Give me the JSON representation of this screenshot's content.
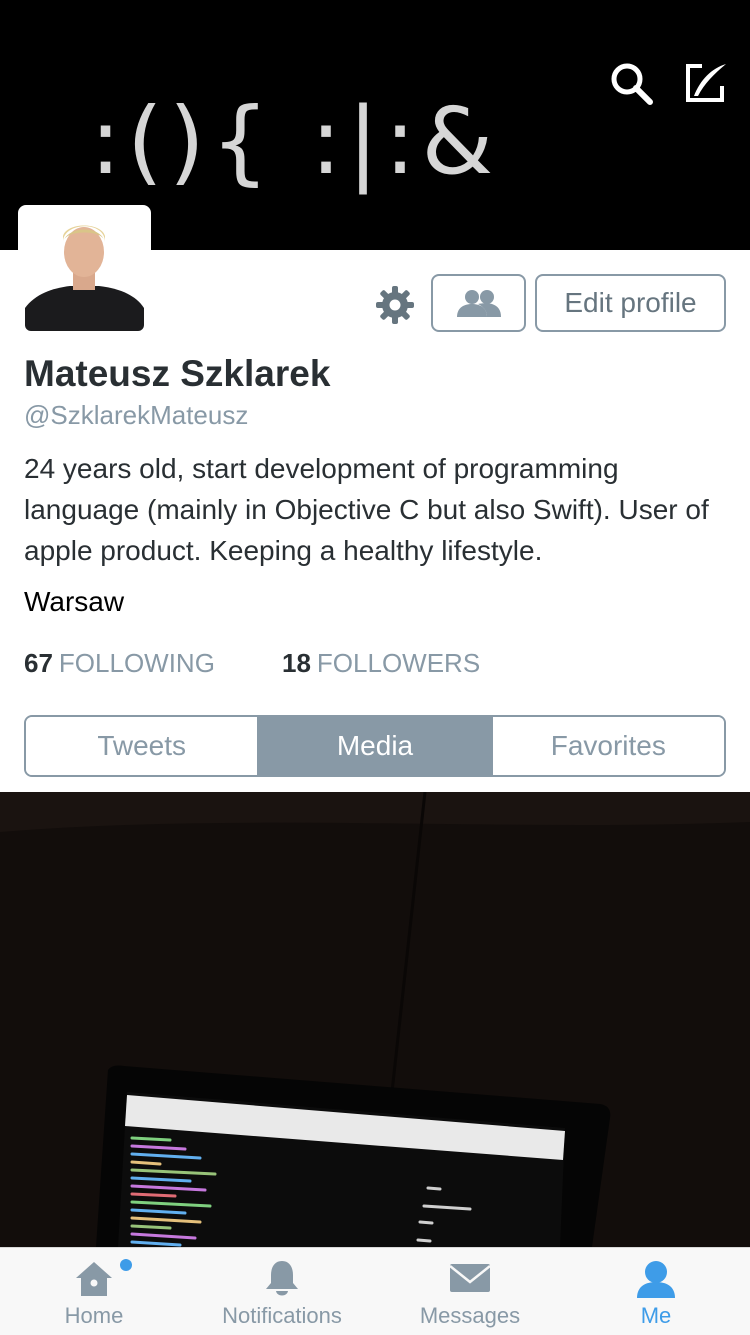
{
  "header": {
    "banner_text": ":(){ :|:&"
  },
  "actions": {
    "edit_profile_label": "Edit profile"
  },
  "profile": {
    "name": "Mateusz Szklarek",
    "handle": "@SzklarekMateusz",
    "bio": "24 years old, start development of programming language (mainly in Objective C but also Swift). User of apple product. Keeping a healthy lifestyle.",
    "location": "Warsaw"
  },
  "stats": {
    "following_count": "67",
    "following_label": "FOLLOWING",
    "followers_count": "18",
    "followers_label": "FOLLOWERS"
  },
  "tabs": [
    {
      "label": "Tweets",
      "active": false
    },
    {
      "label": "Media",
      "active": true
    },
    {
      "label": "Favorites",
      "active": false
    }
  ],
  "tabbar": [
    {
      "label": "Home",
      "icon": "home-icon",
      "has_notification_dot": true
    },
    {
      "label": "Notifications",
      "icon": "bell-icon"
    },
    {
      "label": "Messages",
      "icon": "envelope-icon"
    },
    {
      "label": "Me",
      "icon": "person-icon",
      "active": true
    }
  ],
  "colors": {
    "accent": "#3e9ce8",
    "muted": "#8899a6",
    "text": "#292f33"
  }
}
